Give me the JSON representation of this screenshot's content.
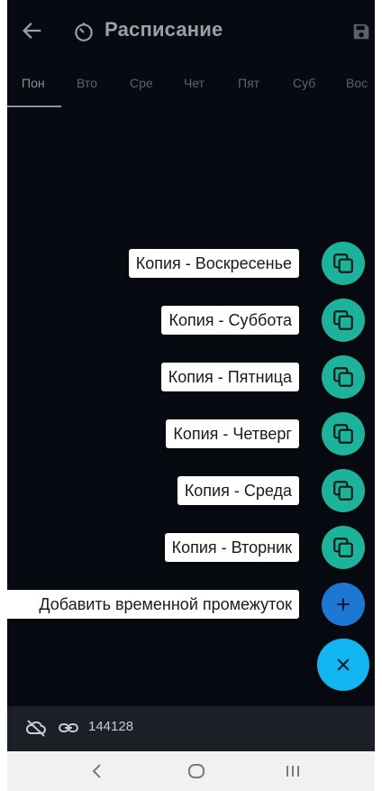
{
  "header": {
    "title": "Расписание",
    "back_icon": "arrow-left-icon",
    "title_icon": "timer-icon",
    "save_icon": "save-icon"
  },
  "tabs": [
    {
      "label": "Пон",
      "active": true
    },
    {
      "label": "Вто",
      "active": false
    },
    {
      "label": "Сре",
      "active": false
    },
    {
      "label": "Чет",
      "active": false
    },
    {
      "label": "Пят",
      "active": false
    },
    {
      "label": "Суб",
      "active": false
    },
    {
      "label": "Вос",
      "active": false
    }
  ],
  "speed_dial": {
    "items": [
      {
        "label": "Копия - Воскресенье",
        "icon": "copy-icon",
        "color": "#1bb49a"
      },
      {
        "label": "Копия - Суббота",
        "icon": "copy-icon",
        "color": "#1bb49a"
      },
      {
        "label": "Копия - Пятница",
        "icon": "copy-icon",
        "color": "#1bb49a"
      },
      {
        "label": "Копия - Четверг",
        "icon": "copy-icon",
        "color": "#1bb49a"
      },
      {
        "label": "Копия - Среда",
        "icon": "copy-icon",
        "color": "#1bb49a"
      },
      {
        "label": "Копия - Вторник",
        "icon": "copy-icon",
        "color": "#1bb49a"
      },
      {
        "label": "Добавить временной промежуток",
        "icon": "plus-icon",
        "color": "#1c78d2"
      }
    ],
    "main_icon": "close-icon",
    "main_color": "#12b6f0"
  },
  "status_bar": {
    "cloud_icon": "cloud-off-icon",
    "link_icon": "link-icon",
    "id": "144128"
  },
  "android_nav": {
    "back_icon": "nav-back-icon",
    "home_icon": "nav-home-icon",
    "recents_icon": "nav-recents-icon"
  }
}
